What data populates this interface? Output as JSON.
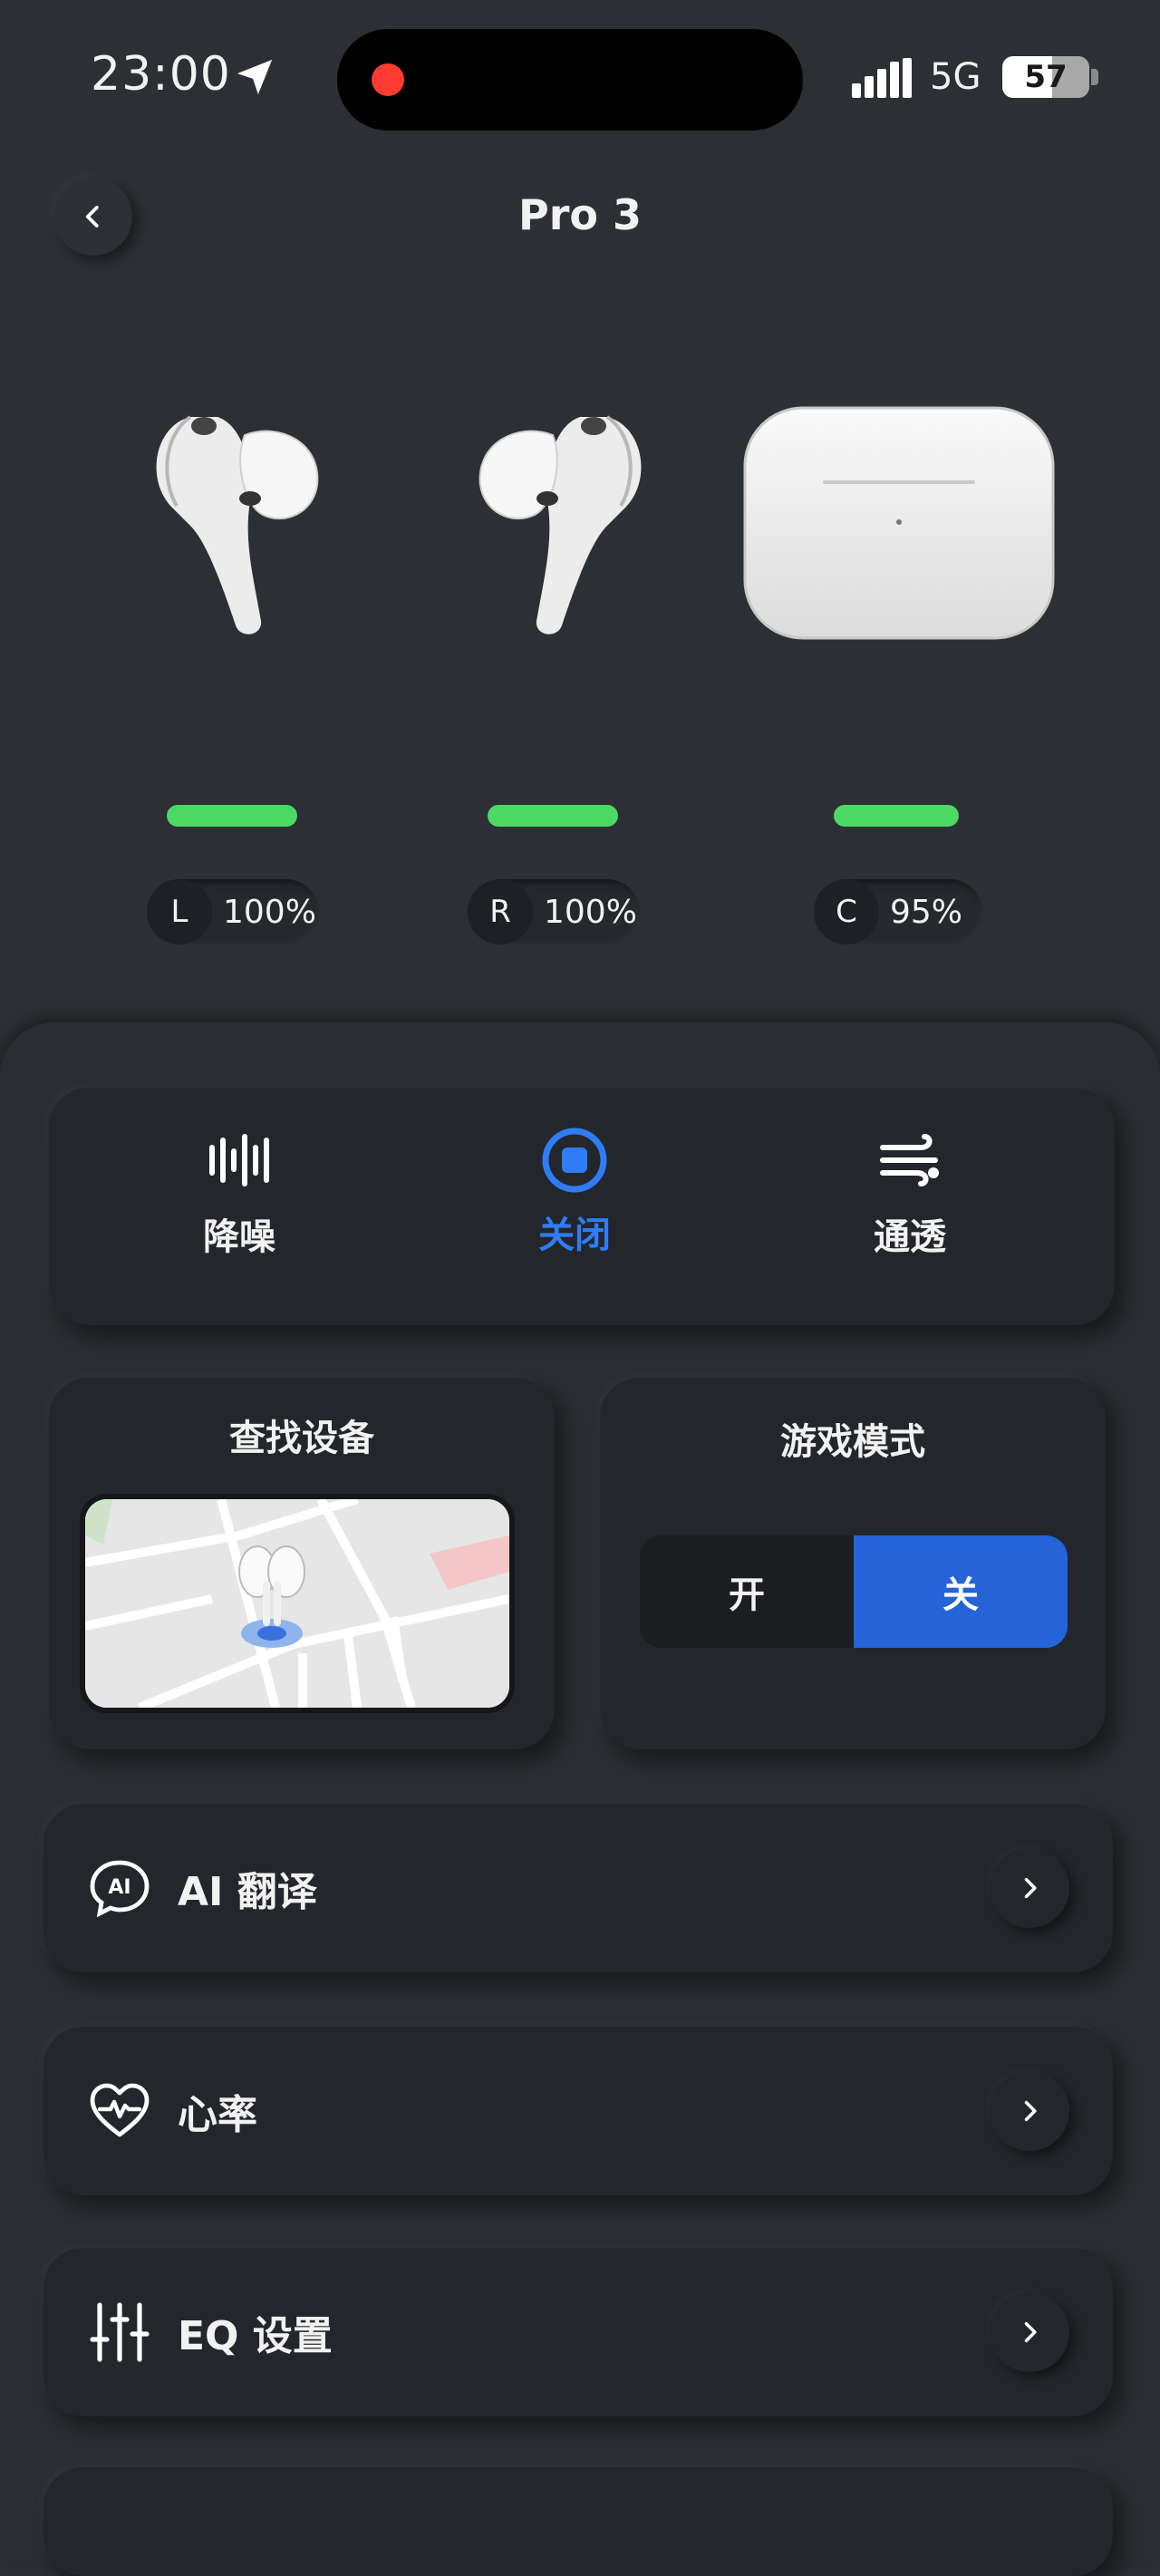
{
  "status_bar": {
    "time": "23:00",
    "network": "5G",
    "battery": "57",
    "battery_level": 0.57
  },
  "header": {
    "title": "Pro 3"
  },
  "devices": [
    {
      "tag": "L",
      "percent": "100%",
      "level": 1.0
    },
    {
      "tag": "R",
      "percent": "100%",
      "level": 1.0
    },
    {
      "tag": "C",
      "percent": "95%",
      "level": 0.95
    }
  ],
  "modes": {
    "items": [
      {
        "label": "降噪",
        "icon": "noise-cancel-icon"
      },
      {
        "label": "关闭",
        "icon": "stop-icon"
      },
      {
        "label": "通透",
        "icon": "wind-icon"
      }
    ],
    "selected": "关闭"
  },
  "find_device": {
    "title": "查找设备"
  },
  "game_mode": {
    "title": "游戏模式",
    "on_label": "开",
    "off_label": "关",
    "value": "关"
  },
  "menu": [
    {
      "label": "AI 翻译",
      "icon": "ai-chat-icon"
    },
    {
      "label": "心率",
      "icon": "heart-rate-icon"
    },
    {
      "label": "EQ 设置",
      "icon": "equalizer-icon"
    }
  ],
  "colors": {
    "background": "#2c2f33",
    "accent": "#2563d9",
    "battery_green": "#4cd964",
    "record_red": "#ff3b30"
  }
}
